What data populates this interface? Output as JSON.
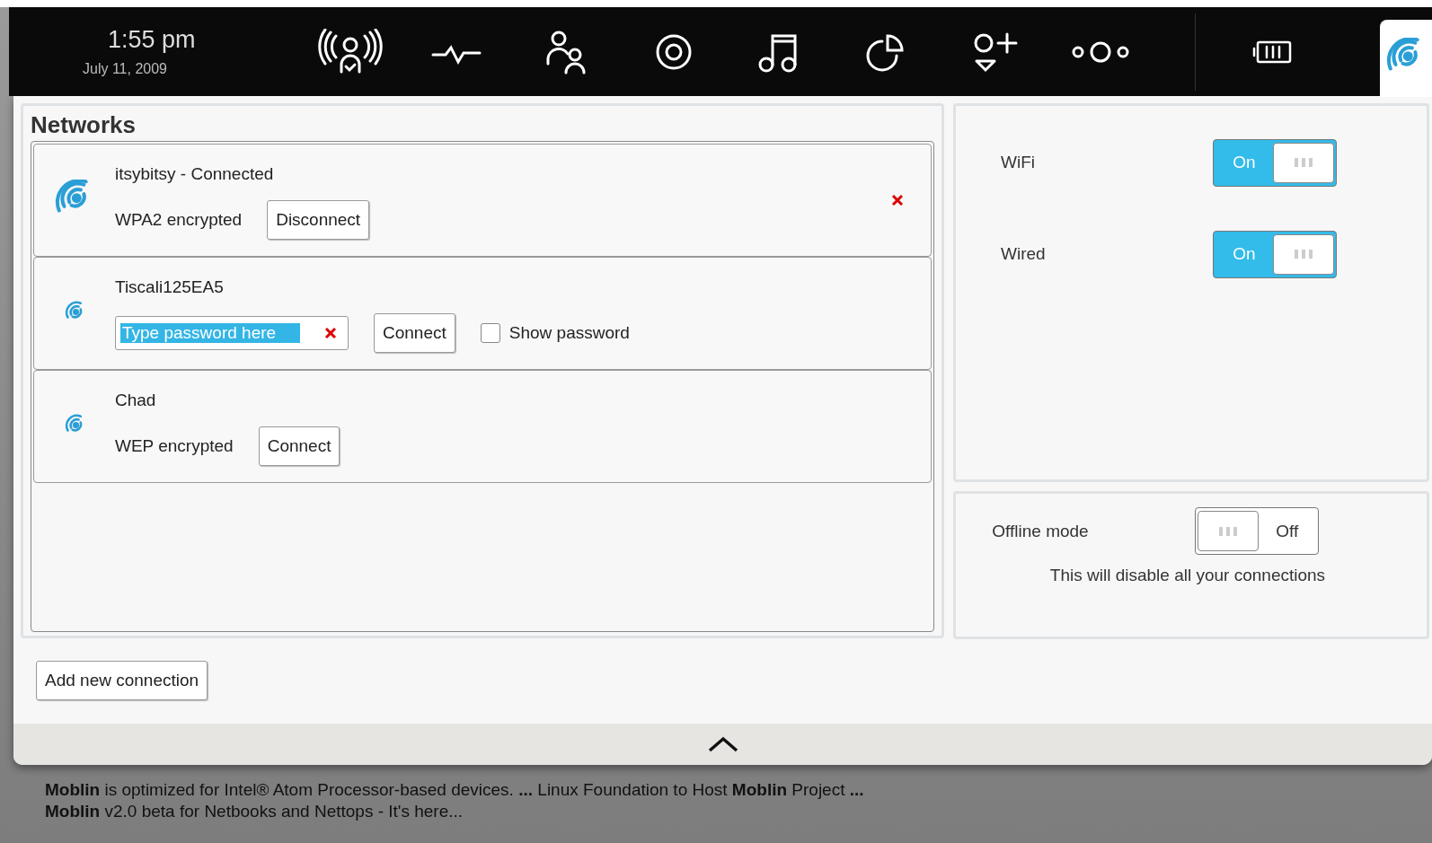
{
  "top_bar": {
    "time": "1:55 pm",
    "date": "July 11, 2009"
  },
  "networks_panel": {
    "title": "Networks",
    "networks": [
      {
        "kind": "connected",
        "name": "itsybitsy - Connected",
        "security": "WPA2 encrypted",
        "button": "Disconnect"
      },
      {
        "kind": "password",
        "name": "Tiscali125EA5",
        "password": "Type password here",
        "button": "Connect",
        "show_password": {
          "label": "Show password",
          "checked": false
        }
      },
      {
        "kind": "encrypted",
        "name": "Chad",
        "security": "WEP encrypted",
        "button": "Connect"
      }
    ]
  },
  "switches": [
    {
      "label": "WiFi",
      "on": true,
      "state": "On"
    },
    {
      "label": "Wired",
      "on": true,
      "state": "On"
    }
  ],
  "offline": {
    "label": "Offline mode",
    "on": false,
    "state": "Off",
    "note": "This will disable all your connections"
  },
  "add_button": "Add new connection",
  "background_result": {
    "snippet": "**Moblin** is optimized for Intel® Atom Processor-based devices. **...** Linux Foundation to Host **Moblin** Project **...** **Moblin** v2.0 beta for Netbooks and Nettops - It's here..."
  }
}
